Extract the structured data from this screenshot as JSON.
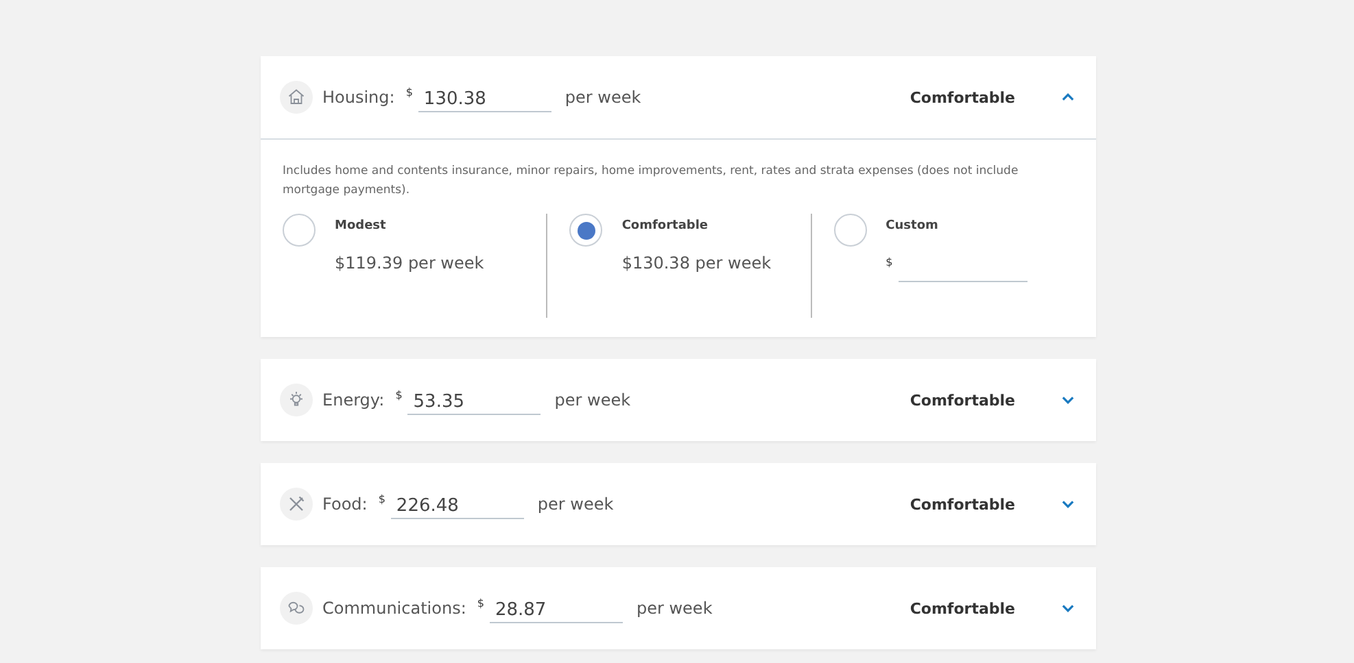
{
  "categories": [
    {
      "kind": "house",
      "label": "Housing:",
      "currency": "$",
      "value": "130.38",
      "unit": "per week",
      "level_name": "Comfortable",
      "expanded": true,
      "description": "Includes home and contents insurance, minor repairs, home improvements, rent, rates and strata expenses (does not include mortgage payments).",
      "options": [
        {
          "kind": "amount",
          "label": "Modest",
          "amount": "$119.39 per week",
          "selected": false
        },
        {
          "kind": "amount",
          "label": "Comfortable",
          "amount": "$130.38 per week",
          "selected": true
        },
        {
          "kind": "custom",
          "label": "Custom",
          "currency": "$",
          "selected": false
        }
      ]
    },
    {
      "kind": "bulb",
      "label": "Energy:",
      "currency": "$",
      "value": "53.35",
      "unit": "per week",
      "level_name": "Comfortable",
      "expanded": false
    },
    {
      "kind": "cutlery",
      "label": "Food:",
      "currency": "$",
      "value": "226.48",
      "unit": "per week",
      "level_name": "Comfortable",
      "expanded": false
    },
    {
      "kind": "chat",
      "label": "Communications:",
      "currency": "$",
      "value": "28.87",
      "unit": "per week",
      "level_name": "Comfortable",
      "expanded": false
    }
  ]
}
